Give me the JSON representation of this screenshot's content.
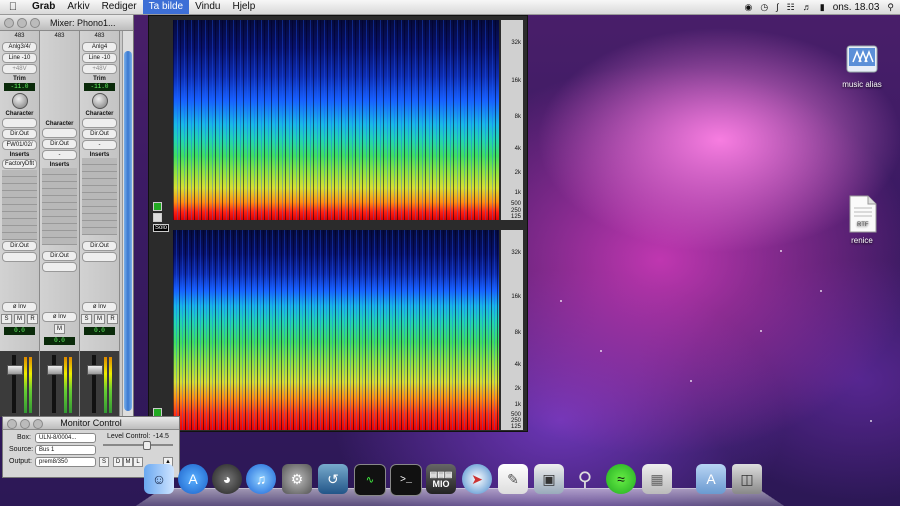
{
  "menubar": {
    "app": "Grab",
    "menus": [
      "Arkiv",
      "Rediger",
      "Ta bilde",
      "Vindu",
      "Hjelp"
    ],
    "active_menu": "Ta bilde",
    "clock": "ons. 18.03"
  },
  "mixer": {
    "title": "Mixer: Phono1...",
    "strips": [
      {
        "num": "483",
        "input": "Anlg3/4/",
        "level": "Line -10",
        "phantom": "+48V",
        "trim_label": "Trim",
        "trim": "-11.0",
        "character": "Character",
        "output": "Dir.Out",
        "bus": "FW01/02/",
        "inserts_label": "Inserts",
        "insert_1": "FactoryDflt",
        "sends_out": "Dir.Out",
        "phase": "ø Inv",
        "buttons": [
          "S",
          "M",
          "R"
        ],
        "gain": "0.0"
      },
      {
        "num": "483",
        "input": "",
        "level": "",
        "phantom": "",
        "trim_label": "",
        "trim": "",
        "character": "Character",
        "output": "Dir.Out",
        "bus": "-",
        "inserts_label": "Inserts",
        "insert_1": "",
        "sends_out": "Dir.Out",
        "phase": "ø Inv",
        "buttons": [
          "M"
        ],
        "gain": "0.0"
      },
      {
        "num": "483",
        "input": "Anlg4",
        "level": "Line -10",
        "phantom": "+48V",
        "trim_label": "Trim",
        "trim": "-11.0",
        "character": "Character",
        "output": "Dir.Out",
        "bus": "-",
        "inserts_label": "Inserts",
        "insert_1": "",
        "sends_out": "Dir.Out",
        "phase": "ø Inv",
        "buttons": [
          "S",
          "M",
          "R"
        ],
        "gain": "0.0"
      }
    ]
  },
  "monitor_control": {
    "title": "Monitor Control",
    "box_label": "Box:",
    "box_value": "ULN-8/0004...",
    "level_label": "Level Control:",
    "level_value": "-14.5",
    "source_label": "Source:",
    "source_value": "Bus 1",
    "output_label": "Output:",
    "output_value": "prem8/350",
    "buttons": [
      "S",
      "D",
      "M",
      "L"
    ]
  },
  "spectrogram": {
    "freq_labels": [
      "32k",
      "16k",
      "8k",
      "4k",
      "2k",
      "1k",
      "500",
      "250",
      "125"
    ],
    "solo_label": "Solo"
  },
  "desktop_icons": [
    {
      "label": "music alias",
      "icon": "network-folder-icon"
    },
    {
      "label": "renice",
      "icon": "rtf-document-icon",
      "badge": "RTF"
    }
  ],
  "dock": {
    "items": [
      "finder",
      "app-store",
      "dashboard",
      "itunes",
      "system-preferences",
      "screen-sharing",
      "activity-monitor",
      "terminal",
      "mio",
      "safari",
      "textedit",
      "preview",
      "grab",
      "spotify",
      "archive-utility",
      "applications-folder",
      "trash"
    ],
    "mio_label": "MIO"
  },
  "colors": {
    "menu_highlight": "#3d6fd6",
    "desktop_accent": "#d83cbe"
  }
}
